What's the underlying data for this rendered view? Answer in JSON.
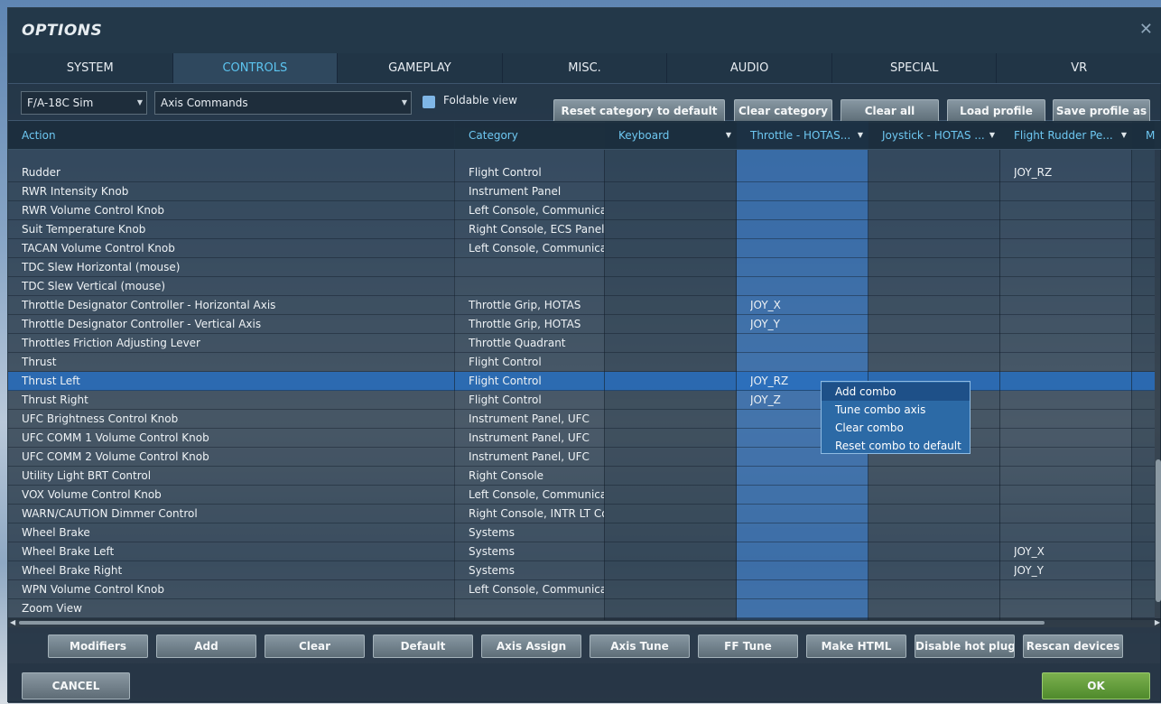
{
  "window": {
    "title": "OPTIONS",
    "close_icon": "close-icon"
  },
  "tabs": [
    {
      "label": "SYSTEM",
      "active": false
    },
    {
      "label": "CONTROLS",
      "active": true
    },
    {
      "label": "GAMEPLAY",
      "active": false
    },
    {
      "label": "MISC.",
      "active": false
    },
    {
      "label": "AUDIO",
      "active": false
    },
    {
      "label": "SPECIAL",
      "active": false
    },
    {
      "label": "VR",
      "active": false
    }
  ],
  "toolbar": {
    "aircraft_select": "F/A-18C Sim",
    "category_select": "Axis Commands",
    "foldable_view_label": "Foldable view",
    "foldable_view_checked": true,
    "buttons": [
      "Reset category to default",
      "Clear category",
      "Clear all",
      "Load profile",
      "Save profile as"
    ]
  },
  "table": {
    "columns": [
      "Action",
      "Category",
      "Keyboard",
      "Throttle - HOTAS...",
      "Joystick - HOTAS ...",
      "Flight Rudder Pe...",
      "M"
    ],
    "rows": [
      {
        "action": "Rudder",
        "category": "Flight Control",
        "keyboard": "",
        "throttle": "",
        "joystick": "",
        "rudder": "JOY_RZ",
        "selected": false
      },
      {
        "action": "RWR Intensity Knob",
        "category": "Instrument Panel",
        "keyboard": "",
        "throttle": "",
        "joystick": "",
        "rudder": "",
        "selected": false
      },
      {
        "action": "RWR Volume Control Knob",
        "category": "Left Console, Communicat",
        "keyboard": "",
        "throttle": "",
        "joystick": "",
        "rudder": "",
        "selected": false
      },
      {
        "action": "Suit Temperature Knob",
        "category": "Right Console, ECS Panel",
        "keyboard": "",
        "throttle": "",
        "joystick": "",
        "rudder": "",
        "selected": false
      },
      {
        "action": "TACAN Volume Control Knob",
        "category": "Left Console, Communicat",
        "keyboard": "",
        "throttle": "",
        "joystick": "",
        "rudder": "",
        "selected": false
      },
      {
        "action": "TDC Slew Horizontal (mouse)",
        "category": "",
        "keyboard": "",
        "throttle": "",
        "joystick": "",
        "rudder": "",
        "selected": false
      },
      {
        "action": "TDC Slew Vertical (mouse)",
        "category": "",
        "keyboard": "",
        "throttle": "",
        "joystick": "",
        "rudder": "",
        "selected": false
      },
      {
        "action": "Throttle Designator Controller - Horizontal Axis",
        "category": "Throttle Grip, HOTAS",
        "keyboard": "",
        "throttle": "JOY_X",
        "joystick": "",
        "rudder": "",
        "selected": false
      },
      {
        "action": "Throttle Designator Controller - Vertical Axis",
        "category": "Throttle Grip, HOTAS",
        "keyboard": "",
        "throttle": "JOY_Y",
        "joystick": "",
        "rudder": "",
        "selected": false
      },
      {
        "action": "Throttles Friction Adjusting Lever",
        "category": "Throttle Quadrant",
        "keyboard": "",
        "throttle": "",
        "joystick": "",
        "rudder": "",
        "selected": false
      },
      {
        "action": "Thrust",
        "category": "Flight Control",
        "keyboard": "",
        "throttle": "",
        "joystick": "",
        "rudder": "",
        "selected": false
      },
      {
        "action": "Thrust Left",
        "category": "Flight Control",
        "keyboard": "",
        "throttle": "JOY_RZ",
        "joystick": "",
        "rudder": "",
        "selected": true
      },
      {
        "action": "Thrust Right",
        "category": "Flight Control",
        "keyboard": "",
        "throttle": "JOY_Z",
        "joystick": "",
        "rudder": "",
        "selected": false
      },
      {
        "action": "UFC Brightness Control Knob",
        "category": "Instrument Panel, UFC",
        "keyboard": "",
        "throttle": "",
        "joystick": "",
        "rudder": "",
        "selected": false
      },
      {
        "action": "UFC COMM 1 Volume Control Knob",
        "category": "Instrument Panel, UFC",
        "keyboard": "",
        "throttle": "",
        "joystick": "",
        "rudder": "",
        "selected": false
      },
      {
        "action": "UFC COMM 2 Volume Control Knob",
        "category": "Instrument Panel, UFC",
        "keyboard": "",
        "throttle": "",
        "joystick": "",
        "rudder": "",
        "selected": false
      },
      {
        "action": "Utility Light BRT Control",
        "category": "Right Console",
        "keyboard": "",
        "throttle": "",
        "joystick": "",
        "rudder": "",
        "selected": false
      },
      {
        "action": "VOX Volume Control Knob",
        "category": "Left Console, Communicat",
        "keyboard": "",
        "throttle": "",
        "joystick": "",
        "rudder": "",
        "selected": false
      },
      {
        "action": "WARN/CAUTION Dimmer Control",
        "category": "Right Console, INTR LT Co",
        "keyboard": "",
        "throttle": "",
        "joystick": "",
        "rudder": "",
        "selected": false
      },
      {
        "action": "Wheel Brake",
        "category": "Systems",
        "keyboard": "",
        "throttle": "",
        "joystick": "",
        "rudder": "",
        "selected": false
      },
      {
        "action": "Wheel Brake Left",
        "category": "Systems",
        "keyboard": "",
        "throttle": "",
        "joystick": "",
        "rudder": "JOY_X",
        "selected": false
      },
      {
        "action": "Wheel Brake Right",
        "category": "Systems",
        "keyboard": "",
        "throttle": "",
        "joystick": "",
        "rudder": "JOY_Y",
        "selected": false
      },
      {
        "action": "WPN Volume Control Knob",
        "category": "Left Console, Communicat",
        "keyboard": "",
        "throttle": "",
        "joystick": "",
        "rudder": "",
        "selected": false
      },
      {
        "action": "Zoom View",
        "category": "",
        "keyboard": "",
        "throttle": "",
        "joystick": "",
        "rudder": "",
        "selected": false
      }
    ]
  },
  "context_menu": {
    "items": [
      "Add combo",
      "Tune combo axis",
      "Clear combo",
      "Reset combo to default"
    ],
    "highlighted_index": 0
  },
  "bottom_buttons": [
    "Modifiers",
    "Add",
    "Clear",
    "Default",
    "Axis Assign",
    "Axis Tune",
    "FF Tune",
    "Make HTML",
    "Disable hot plug",
    "Rescan devices"
  ],
  "footer": {
    "cancel": "CANCEL",
    "ok": "OK"
  },
  "colors": {
    "accent_blue": "#5cc4f0",
    "selection": "#286ebe",
    "ok_green": "#6aa043"
  }
}
